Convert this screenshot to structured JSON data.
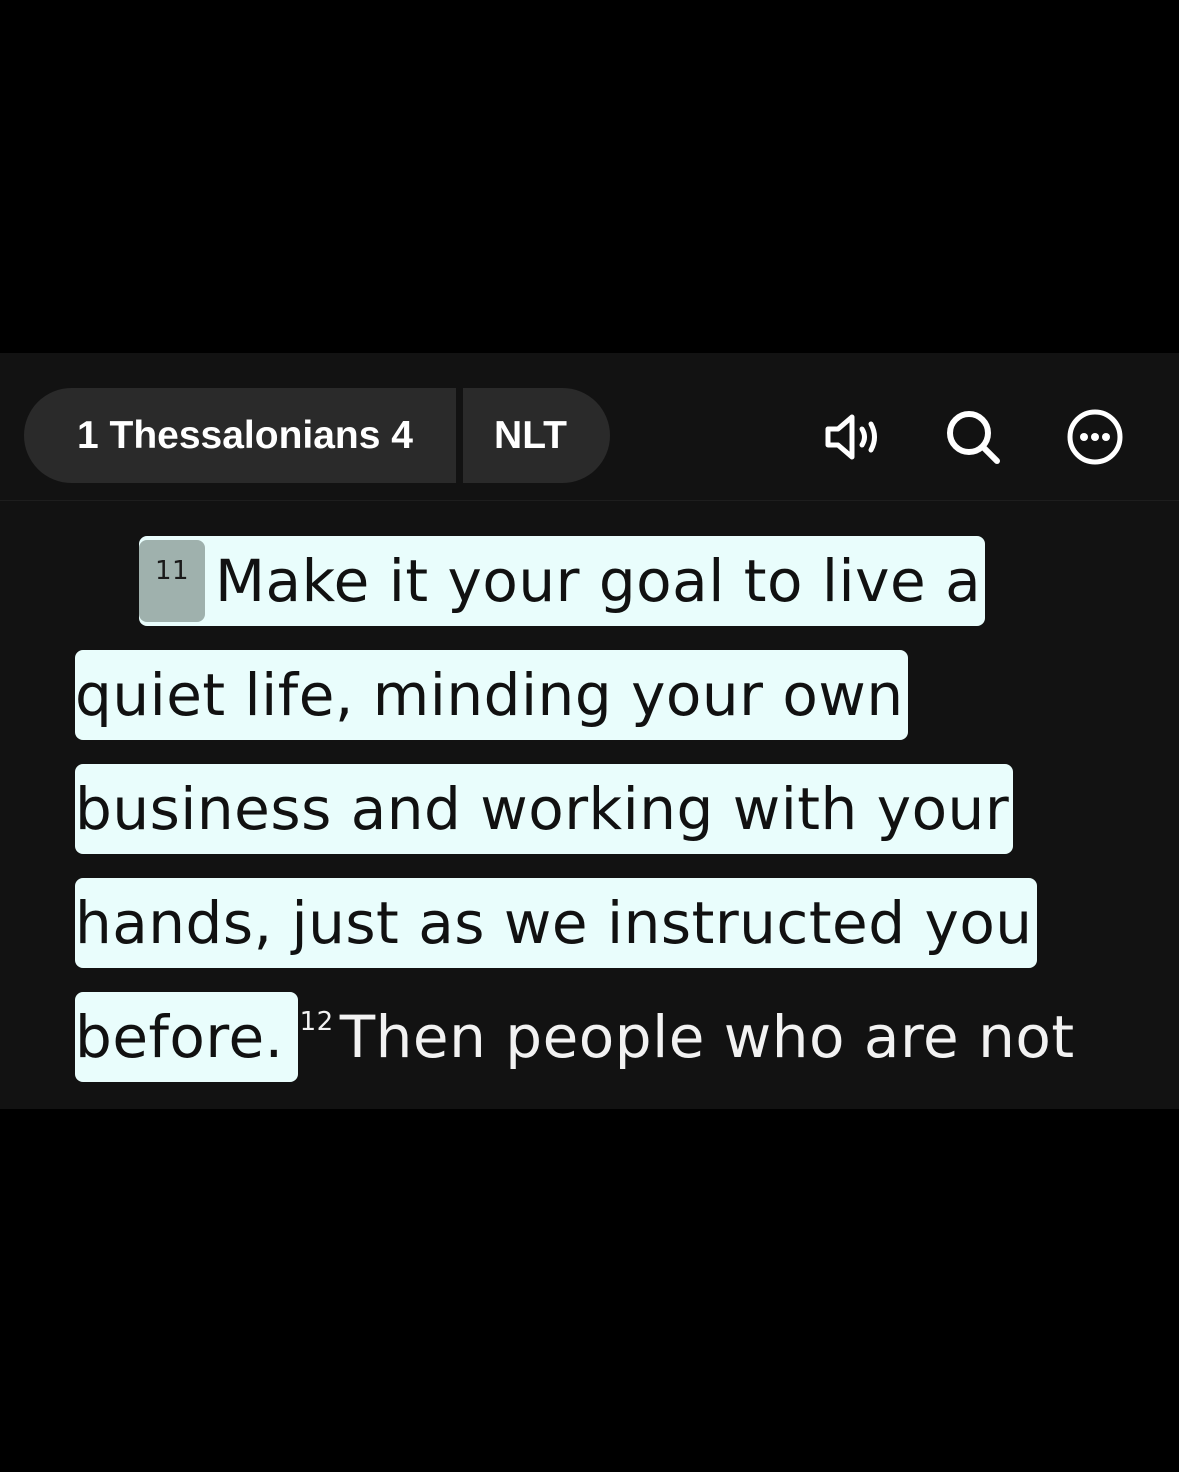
{
  "header": {
    "book_chapter": "1 Thessalonians 4",
    "version": "NLT",
    "icons": {
      "audio": "speaker-icon",
      "search": "search-icon",
      "more": "more-options-icon"
    }
  },
  "reader": {
    "verse_11_number": "11",
    "line1": "Make it your goal to live a",
    "line2": "quiet life, minding your own",
    "line3": "business and working with your",
    "line4": "hands, just as we instructed you",
    "line5_highlight": "before.",
    "verse_12_number": "12",
    "line5_rest": "Then people who are not"
  },
  "colors": {
    "background": "#000000",
    "panel": "#121212",
    "pill": "#2a2a2a",
    "highlight": "#e9fdfc",
    "verse_badge": "#9fb1ad"
  }
}
